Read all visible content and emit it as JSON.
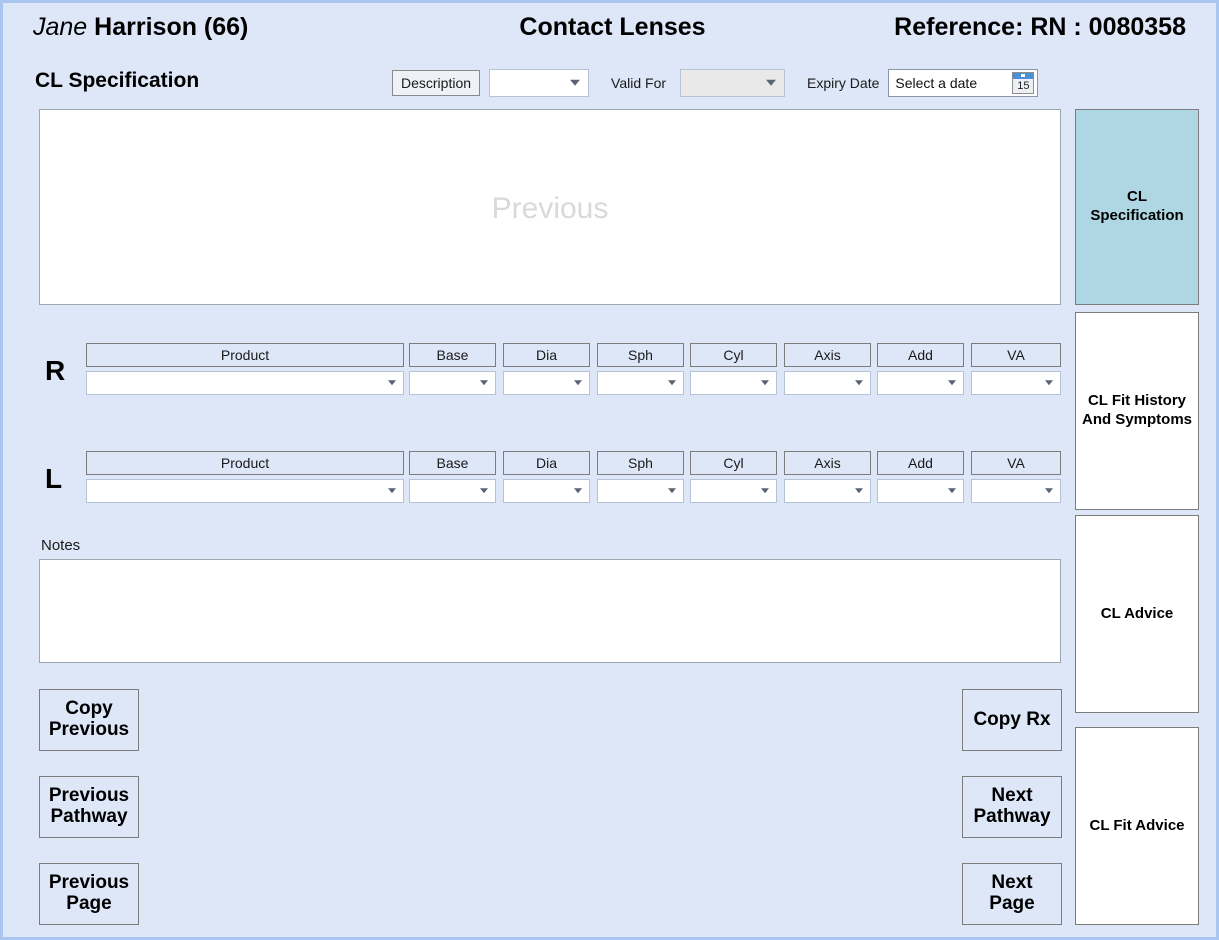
{
  "header": {
    "patient_given": "Jane",
    "patient_rest": "Harrison (66)",
    "title": "Contact Lenses",
    "reference": "Reference: RN : 0080358"
  },
  "spec": {
    "section_title": "CL Specification",
    "description_button": "Description",
    "description_value": "",
    "valid_for_label": "Valid For",
    "valid_for_value": "",
    "expiry_label": "Expiry Date",
    "expiry_placeholder": "Select a date",
    "calendar_day": "15"
  },
  "previous_panel": {
    "watermark": "Previous"
  },
  "table": {
    "columns": [
      "Product",
      "Base",
      "Dia",
      "Sph",
      "Cyl",
      "Axis",
      "Add",
      "VA"
    ],
    "rows": [
      {
        "eye": "R",
        "values": [
          "",
          "",
          "",
          "",
          "",
          "",
          "",
          ""
        ]
      },
      {
        "eye": "L",
        "values": [
          "",
          "",
          "",
          "",
          "",
          "",
          "",
          ""
        ]
      }
    ]
  },
  "notes": {
    "label": "Notes",
    "value": ""
  },
  "buttons": {
    "copy_previous": "Copy Previous",
    "previous_pathway": "Previous Pathway",
    "previous_page": "Previous Page",
    "copy_rx": "Copy Rx",
    "next_pathway": "Next Pathway",
    "next_page": "Next Page"
  },
  "tabs": [
    {
      "label": "CL Specification",
      "active": true
    },
    {
      "label": "CL Fit History And Symptoms",
      "active": false
    },
    {
      "label": "CL Advice",
      "active": false
    },
    {
      "label": "CL Fit Advice",
      "active": false
    }
  ],
  "colors": {
    "page_background": "#dde7f8",
    "page_border": "#a8c6f0",
    "active_tab": "#afd7e3",
    "watermark_text": "#d7d9dd"
  }
}
